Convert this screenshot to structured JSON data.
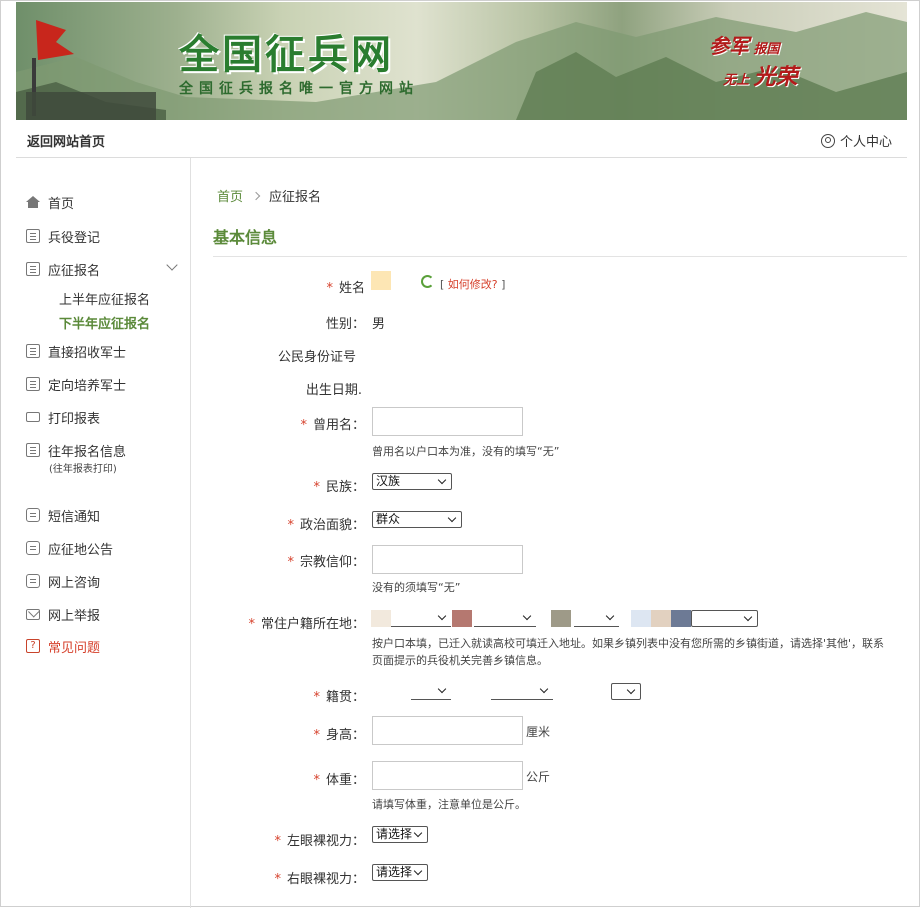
{
  "banner": {
    "title": "全国征兵网",
    "subtitle": "全国征兵报名唯一官方网站",
    "slogan": [
      "参军",
      "报国",
      "无上",
      "光荣"
    ]
  },
  "topnav": {
    "home_link": "返回网站首页",
    "user_center": "个人中心"
  },
  "sidebar": {
    "items": [
      {
        "label": "首页",
        "icon": "home-icon"
      },
      {
        "label": "兵役登记",
        "icon": "id-card-icon"
      },
      {
        "label": "应征报名",
        "icon": "form-icon"
      },
      {
        "label": "直接招收军士",
        "icon": "id-card-icon"
      },
      {
        "label": "定向培养军士",
        "icon": "id-card-icon"
      },
      {
        "label": "打印报表",
        "icon": "printer-icon"
      },
      {
        "label": "往年报名信息",
        "icon": "history-icon",
        "note": "(往年报表打印)"
      },
      {
        "label": "短信通知",
        "icon": "chat-icon"
      },
      {
        "label": "应征地公告",
        "icon": "chat-icon"
      },
      {
        "label": "网上咨询",
        "icon": "chat-icon"
      },
      {
        "label": "网上举报",
        "icon": "mail-icon"
      },
      {
        "label": "常见问题",
        "icon": "help-icon"
      }
    ],
    "sub_items": [
      "上半年应征报名",
      "下半年应征报名"
    ]
  },
  "breadcrumb": {
    "home": "首页",
    "current": "应征报名"
  },
  "section_title": "基本信息",
  "form": {
    "name_label": "姓名",
    "modify_link_open": "[",
    "modify_link": "如何修改?",
    "modify_link_close": "]",
    "gender_label": "性别：",
    "gender_value": "男",
    "id_label": "公民身份证号",
    "birth_label": "出生日期.",
    "alias_label": "曾用名：",
    "alias_hint": "曾用名以户口本为准，没有的填写“无”",
    "ethnic_label": "民族：",
    "ethnic_value": "汉族",
    "political_label": "政治面貌：",
    "political_value": "群众",
    "religion_label": "宗教信仰：",
    "religion_hint": "没有的须填写“无”",
    "residence_label": "常住户籍所在地：",
    "residence_hint_1": "按户口本填，已迁入就读高校可填迁入地址。如果乡镇列表中没有您所需的乡镇街道，请选择'其他'，联系",
    "residence_hint_2": "页面提示的兵役机关完善乡镇信息。",
    "native_label": "籍贯：",
    "height_label": "身高：",
    "height_unit": "厘米",
    "weight_label": "体重：",
    "weight_unit": "公斤",
    "weight_hint": "请填写体重，注意单位是公斤。",
    "left_eye_label": "左眼裸视力：",
    "left_eye_value": "请选择",
    "right_eye_label": "右眼裸视力：",
    "right_eye_value": "请选择"
  },
  "colors": {
    "accent_green": "#5b8a3a",
    "required_red": "#d6402b",
    "banner_title": "#2a7d2f",
    "slogan_red": "#b31a1a",
    "redaction_swatches": [
      "#f2e9dd",
      "#b57870",
      "#9e9a88",
      "#dde6f2",
      "#e2d1c0",
      "#6d7a95",
      "#fde6b4"
    ]
  }
}
